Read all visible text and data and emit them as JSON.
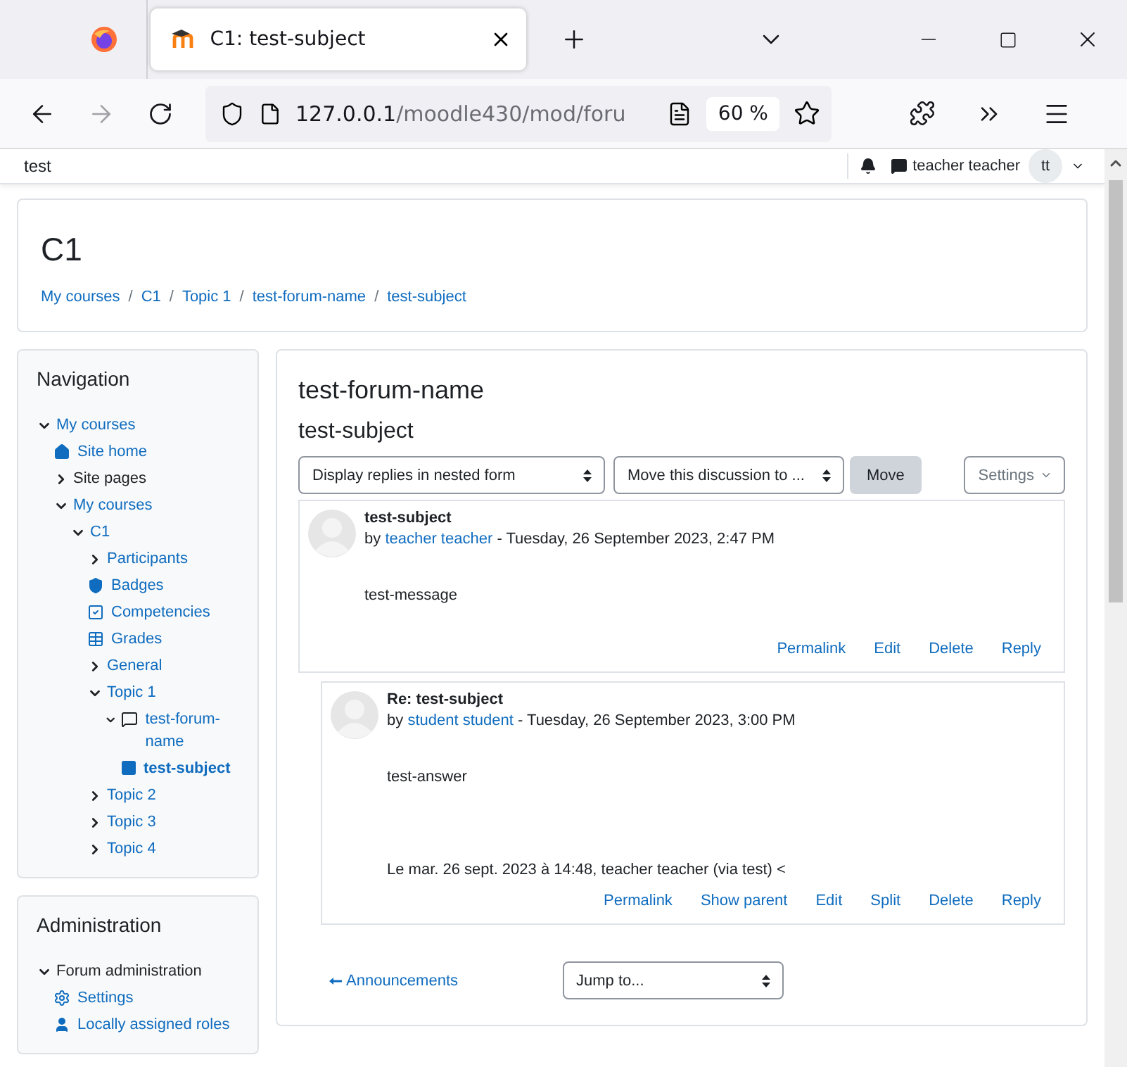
{
  "browser": {
    "tab_title": "C1: test-subject",
    "url_host": "127.0.0.1",
    "url_path": "/moodle430/mod/foru",
    "zoom": "60 %"
  },
  "navbar": {
    "site": "test",
    "user": "teacher teacher",
    "avatar": "tt"
  },
  "course": {
    "title": "C1",
    "separator": "/",
    "breadcrumb": [
      "My courses",
      "C1",
      "Topic 1",
      "test-forum-name",
      "test-subject"
    ]
  },
  "navigation": {
    "title": "Navigation",
    "items": [
      {
        "label": "My courses",
        "expanded": true,
        "link": true,
        "selected": false,
        "children": [
          {
            "label": "Site home",
            "kind": "home",
            "link": true,
            "selected": false
          },
          {
            "label": "Site pages",
            "expanded": false,
            "link": false,
            "selected": false
          },
          {
            "label": "My courses",
            "expanded": true,
            "link": true,
            "selected": false,
            "children": [
              {
                "label": "C1",
                "expanded": true,
                "link": true,
                "selected": false,
                "children": [
                  {
                    "label": "Participants",
                    "expanded": false,
                    "link": true,
                    "selected": false
                  },
                  {
                    "label": "Badges",
                    "kind": "badge",
                    "link": true,
                    "selected": false
                  },
                  {
                    "label": "Competencies",
                    "kind": "competency",
                    "link": true,
                    "selected": false
                  },
                  {
                    "label": "Grades",
                    "kind": "grades",
                    "link": true,
                    "selected": false
                  },
                  {
                    "label": "General",
                    "expanded": false,
                    "link": true,
                    "selected": false
                  },
                  {
                    "label": "Topic 1",
                    "expanded": true,
                    "link": true,
                    "selected": false,
                    "children": [
                      {
                        "label": "test-forum-name",
                        "kind": "forum",
                        "expanded": true,
                        "link": true,
                        "selected": false,
                        "children": [
                          {
                            "label": "test-subject",
                            "kind": "discussion",
                            "link": true,
                            "selected": true
                          }
                        ]
                      }
                    ]
                  },
                  {
                    "label": "Topic 2",
                    "expanded": false,
                    "link": true,
                    "selected": false
                  },
                  {
                    "label": "Topic 3",
                    "expanded": false,
                    "link": true,
                    "selected": false
                  },
                  {
                    "label": "Topic 4",
                    "expanded": false,
                    "link": true,
                    "selected": false
                  }
                ]
              }
            ]
          }
        ]
      }
    ]
  },
  "administration": {
    "title": "Administration",
    "items": [
      {
        "label": "Forum administration",
        "expanded": true,
        "link": false,
        "selected": false,
        "children": [
          {
            "label": "Settings",
            "kind": "settings",
            "link": true,
            "selected": false
          },
          {
            "label": "Locally assigned roles",
            "kind": "roles",
            "link": true,
            "selected": false
          }
        ]
      }
    ]
  },
  "forum": {
    "title": "test-forum-name",
    "subject": "test-subject",
    "display_mode": "Display replies in nested form",
    "move_target": "Move this discussion to ...",
    "move_button": "Move",
    "settings_button": "Settings",
    "posts": [
      {
        "subject": "test-subject",
        "by": "by",
        "author": "teacher teacher",
        "date": "- Tuesday, 26 September 2023, 2:47 PM",
        "message": "test-message",
        "actions": [
          "Permalink",
          "Edit",
          "Delete",
          "Reply"
        ],
        "children": [
          {
            "subject": "Re: test-subject",
            "by": "by",
            "author": "student student",
            "date": "- Tuesday, 26 September 2023, 3:00 PM",
            "message": "test-answer",
            "quote": "Le mar. 26 sept. 2023 à 14:48, teacher teacher (via test) <",
            "actions": [
              "Permalink",
              "Show parent",
              "Edit",
              "Split",
              "Delete",
              "Reply"
            ]
          }
        ]
      }
    ],
    "previous_link": "Announcements",
    "jump_to": "Jump to..."
  }
}
